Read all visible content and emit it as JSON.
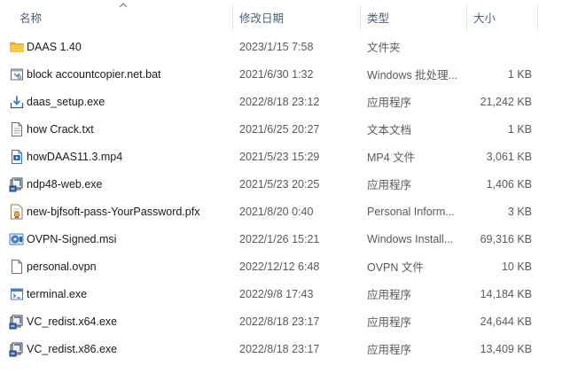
{
  "columns": {
    "name": "名称",
    "date": "修改日期",
    "type": "类型",
    "size": "大小"
  },
  "files": [
    {
      "name": "DAAS 1.40",
      "date": "2023/1/15 7:58",
      "type": "文件夹",
      "size": "",
      "icon": "folder-icon"
    },
    {
      "name": "block accountcopier.net.bat",
      "date": "2021/6/30 1:32",
      "type": "Windows 批处理...",
      "size": "1 KB",
      "icon": "batch-file-icon"
    },
    {
      "name": "daas_setup.exe",
      "date": "2022/8/18 23:12",
      "type": "应用程序",
      "size": "21,242 KB",
      "icon": "installer-icon"
    },
    {
      "name": "how Crack.txt",
      "date": "2021/6/25 20:27",
      "type": "文本文档",
      "size": "1 KB",
      "icon": "text-file-icon"
    },
    {
      "name": "howDAAS11.3.mp4",
      "date": "2021/5/23 15:29",
      "type": "MP4 文件",
      "size": "3,061 KB",
      "icon": "video-file-icon"
    },
    {
      "name": "ndp48-web.exe",
      "date": "2021/5/23 20:25",
      "type": "应用程序",
      "size": "1,406 KB",
      "icon": "setup-exe-icon"
    },
    {
      "name": "new-bjfsoft-pass-YourPassword.pfx",
      "date": "2021/8/20 0:40",
      "type": "Personal Inform...",
      "size": "3 KB",
      "icon": "certificate-icon"
    },
    {
      "name": "OVPN-Signed.msi",
      "date": "2022/1/26 15:21",
      "type": "Windows Install...",
      "size": "69,316 KB",
      "icon": "msi-package-icon"
    },
    {
      "name": "personal.ovpn",
      "date": "2022/12/12 6:48",
      "type": "OVPN 文件",
      "size": "10 KB",
      "icon": "blank-file-icon"
    },
    {
      "name": "terminal.exe",
      "date": "2022/9/8 17:43",
      "type": "应用程序",
      "size": "14,184 KB",
      "icon": "app-window-icon"
    },
    {
      "name": "VC_redist.x64.exe",
      "date": "2022/8/18 23:17",
      "type": "应用程序",
      "size": "24,644 KB",
      "icon": "setup-exe-icon"
    },
    {
      "name": "VC_redist.x86.exe",
      "date": "2022/8/18 23:17",
      "type": "应用程序",
      "size": "13,409 KB",
      "icon": "setup-exe-icon"
    }
  ],
  "colors": {
    "header_text": "#4c607a",
    "secondary_text": "#5a5a5a",
    "folder": "#f2c14e"
  }
}
